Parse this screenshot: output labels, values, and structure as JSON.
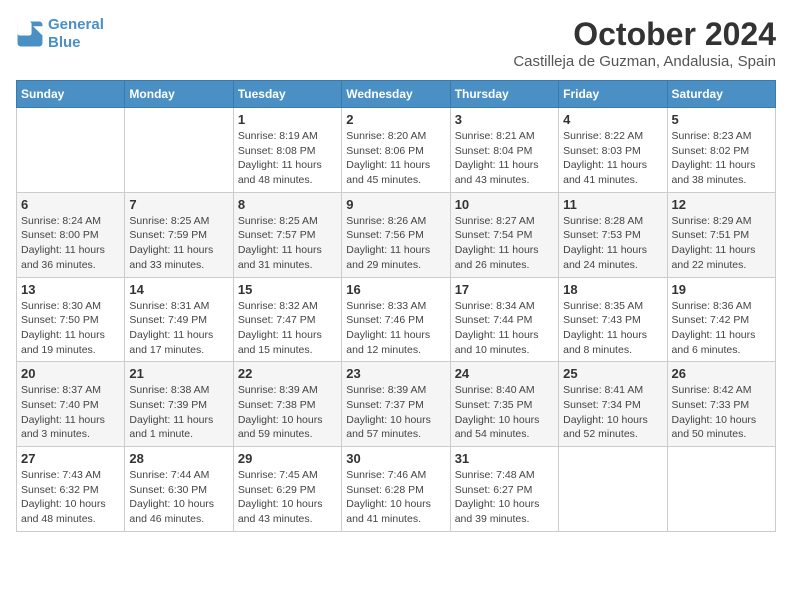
{
  "header": {
    "logo_line1": "General",
    "logo_line2": "Blue",
    "month_title": "October 2024",
    "location": "Castilleja de Guzman, Andalusia, Spain"
  },
  "days_of_week": [
    "Sunday",
    "Monday",
    "Tuesday",
    "Wednesday",
    "Thursday",
    "Friday",
    "Saturday"
  ],
  "weeks": [
    [
      {
        "day": "",
        "sunrise": "",
        "sunset": "",
        "daylight": ""
      },
      {
        "day": "",
        "sunrise": "",
        "sunset": "",
        "daylight": ""
      },
      {
        "day": "1",
        "sunrise": "Sunrise: 8:19 AM",
        "sunset": "Sunset: 8:08 PM",
        "daylight": "Daylight: 11 hours and 48 minutes."
      },
      {
        "day": "2",
        "sunrise": "Sunrise: 8:20 AM",
        "sunset": "Sunset: 8:06 PM",
        "daylight": "Daylight: 11 hours and 45 minutes."
      },
      {
        "day": "3",
        "sunrise": "Sunrise: 8:21 AM",
        "sunset": "Sunset: 8:04 PM",
        "daylight": "Daylight: 11 hours and 43 minutes."
      },
      {
        "day": "4",
        "sunrise": "Sunrise: 8:22 AM",
        "sunset": "Sunset: 8:03 PM",
        "daylight": "Daylight: 11 hours and 41 minutes."
      },
      {
        "day": "5",
        "sunrise": "Sunrise: 8:23 AM",
        "sunset": "Sunset: 8:02 PM",
        "daylight": "Daylight: 11 hours and 38 minutes."
      }
    ],
    [
      {
        "day": "6",
        "sunrise": "Sunrise: 8:24 AM",
        "sunset": "Sunset: 8:00 PM",
        "daylight": "Daylight: 11 hours and 36 minutes."
      },
      {
        "day": "7",
        "sunrise": "Sunrise: 8:25 AM",
        "sunset": "Sunset: 7:59 PM",
        "daylight": "Daylight: 11 hours and 33 minutes."
      },
      {
        "day": "8",
        "sunrise": "Sunrise: 8:25 AM",
        "sunset": "Sunset: 7:57 PM",
        "daylight": "Daylight: 11 hours and 31 minutes."
      },
      {
        "day": "9",
        "sunrise": "Sunrise: 8:26 AM",
        "sunset": "Sunset: 7:56 PM",
        "daylight": "Daylight: 11 hours and 29 minutes."
      },
      {
        "day": "10",
        "sunrise": "Sunrise: 8:27 AM",
        "sunset": "Sunset: 7:54 PM",
        "daylight": "Daylight: 11 hours and 26 minutes."
      },
      {
        "day": "11",
        "sunrise": "Sunrise: 8:28 AM",
        "sunset": "Sunset: 7:53 PM",
        "daylight": "Daylight: 11 hours and 24 minutes."
      },
      {
        "day": "12",
        "sunrise": "Sunrise: 8:29 AM",
        "sunset": "Sunset: 7:51 PM",
        "daylight": "Daylight: 11 hours and 22 minutes."
      }
    ],
    [
      {
        "day": "13",
        "sunrise": "Sunrise: 8:30 AM",
        "sunset": "Sunset: 7:50 PM",
        "daylight": "Daylight: 11 hours and 19 minutes."
      },
      {
        "day": "14",
        "sunrise": "Sunrise: 8:31 AM",
        "sunset": "Sunset: 7:49 PM",
        "daylight": "Daylight: 11 hours and 17 minutes."
      },
      {
        "day": "15",
        "sunrise": "Sunrise: 8:32 AM",
        "sunset": "Sunset: 7:47 PM",
        "daylight": "Daylight: 11 hours and 15 minutes."
      },
      {
        "day": "16",
        "sunrise": "Sunrise: 8:33 AM",
        "sunset": "Sunset: 7:46 PM",
        "daylight": "Daylight: 11 hours and 12 minutes."
      },
      {
        "day": "17",
        "sunrise": "Sunrise: 8:34 AM",
        "sunset": "Sunset: 7:44 PM",
        "daylight": "Daylight: 11 hours and 10 minutes."
      },
      {
        "day": "18",
        "sunrise": "Sunrise: 8:35 AM",
        "sunset": "Sunset: 7:43 PM",
        "daylight": "Daylight: 11 hours and 8 minutes."
      },
      {
        "day": "19",
        "sunrise": "Sunrise: 8:36 AM",
        "sunset": "Sunset: 7:42 PM",
        "daylight": "Daylight: 11 hours and 6 minutes."
      }
    ],
    [
      {
        "day": "20",
        "sunrise": "Sunrise: 8:37 AM",
        "sunset": "Sunset: 7:40 PM",
        "daylight": "Daylight: 11 hours and 3 minutes."
      },
      {
        "day": "21",
        "sunrise": "Sunrise: 8:38 AM",
        "sunset": "Sunset: 7:39 PM",
        "daylight": "Daylight: 11 hours and 1 minute."
      },
      {
        "day": "22",
        "sunrise": "Sunrise: 8:39 AM",
        "sunset": "Sunset: 7:38 PM",
        "daylight": "Daylight: 10 hours and 59 minutes."
      },
      {
        "day": "23",
        "sunrise": "Sunrise: 8:39 AM",
        "sunset": "Sunset: 7:37 PM",
        "daylight": "Daylight: 10 hours and 57 minutes."
      },
      {
        "day": "24",
        "sunrise": "Sunrise: 8:40 AM",
        "sunset": "Sunset: 7:35 PM",
        "daylight": "Daylight: 10 hours and 54 minutes."
      },
      {
        "day": "25",
        "sunrise": "Sunrise: 8:41 AM",
        "sunset": "Sunset: 7:34 PM",
        "daylight": "Daylight: 10 hours and 52 minutes."
      },
      {
        "day": "26",
        "sunrise": "Sunrise: 8:42 AM",
        "sunset": "Sunset: 7:33 PM",
        "daylight": "Daylight: 10 hours and 50 minutes."
      }
    ],
    [
      {
        "day": "27",
        "sunrise": "Sunrise: 7:43 AM",
        "sunset": "Sunset: 6:32 PM",
        "daylight": "Daylight: 10 hours and 48 minutes."
      },
      {
        "day": "28",
        "sunrise": "Sunrise: 7:44 AM",
        "sunset": "Sunset: 6:30 PM",
        "daylight": "Daylight: 10 hours and 46 minutes."
      },
      {
        "day": "29",
        "sunrise": "Sunrise: 7:45 AM",
        "sunset": "Sunset: 6:29 PM",
        "daylight": "Daylight: 10 hours and 43 minutes."
      },
      {
        "day": "30",
        "sunrise": "Sunrise: 7:46 AM",
        "sunset": "Sunset: 6:28 PM",
        "daylight": "Daylight: 10 hours and 41 minutes."
      },
      {
        "day": "31",
        "sunrise": "Sunrise: 7:48 AM",
        "sunset": "Sunset: 6:27 PM",
        "daylight": "Daylight: 10 hours and 39 minutes."
      },
      {
        "day": "",
        "sunrise": "",
        "sunset": "",
        "daylight": ""
      },
      {
        "day": "",
        "sunrise": "",
        "sunset": "",
        "daylight": ""
      }
    ]
  ]
}
